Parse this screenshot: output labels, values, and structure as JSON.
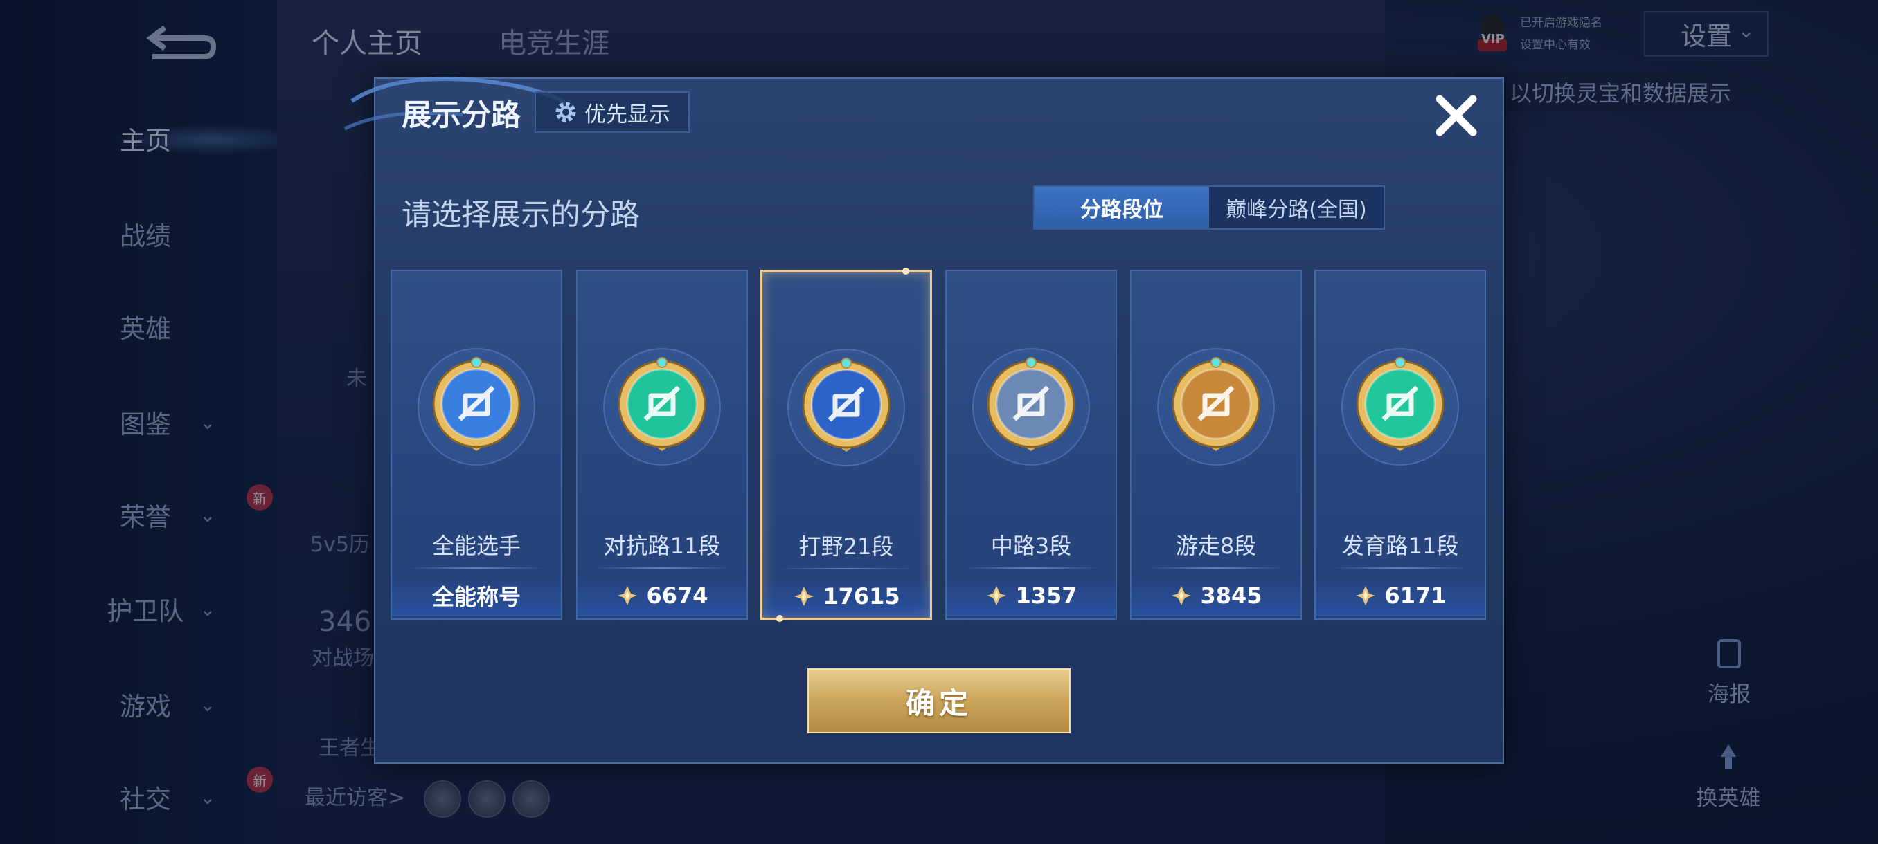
{
  "background": {
    "nav": [
      {
        "label": "主页",
        "chevron": false,
        "active": true,
        "badge": ""
      },
      {
        "label": "战绩",
        "chevron": false,
        "active": false,
        "badge": ""
      },
      {
        "label": "英雄",
        "chevron": false,
        "active": false,
        "badge": ""
      },
      {
        "label": "图鉴",
        "chevron": true,
        "active": false,
        "badge": ""
      },
      {
        "label": "荣誉",
        "chevron": true,
        "active": false,
        "badge": "新"
      },
      {
        "label": "护卫队",
        "chevron": true,
        "active": false,
        "badge": ""
      },
      {
        "label": "游戏",
        "chevron": true,
        "active": false,
        "badge": ""
      },
      {
        "label": "社交",
        "chevron": true,
        "active": false,
        "badge": "新"
      }
    ],
    "tabs": [
      "个人主页",
      "电竞生涯"
    ],
    "recent_visitors_label": "最近访客>",
    "partial_texts": [
      "5v5历",
      "346",
      "对战场",
      "王者生",
      "未"
    ],
    "vip_label": "VIP",
    "vip_line1": "已开启游戏隐名",
    "vip_line2": "设置中心有效",
    "settings_label": "设置",
    "hint_text": "以切换灵宝和数据展示",
    "right_widgets": [
      "海报",
      "换英雄"
    ]
  },
  "modal": {
    "title": "展示分路",
    "priority_button": "优先显示",
    "subtitle": "请选择展示的分路",
    "segments": [
      {
        "label": "分路段位",
        "active": true
      },
      {
        "label": "巅峰分路(全国)",
        "active": false
      }
    ],
    "cards": [
      {
        "lane": "全能选手",
        "score": "全能称号",
        "has_gem": false,
        "selected": false,
        "badge_color": "#3a7fe0",
        "badge_icon": "all-round-icon"
      },
      {
        "lane": "对抗路11段",
        "score": "6674",
        "has_gem": true,
        "selected": false,
        "badge_color": "#1fc49a",
        "badge_icon": "clash-lane-icon"
      },
      {
        "lane": "打野21段",
        "score": "17615",
        "has_gem": true,
        "selected": true,
        "badge_color": "#2e63c9",
        "badge_icon": "jungle-icon"
      },
      {
        "lane": "中路3段",
        "score": "1357",
        "has_gem": true,
        "selected": false,
        "badge_color": "#6c88b4",
        "badge_icon": "mid-lane-icon"
      },
      {
        "lane": "游走8段",
        "score": "3845",
        "has_gem": true,
        "selected": false,
        "badge_color": "#c88a3a",
        "badge_icon": "roam-icon"
      },
      {
        "lane": "发育路11段",
        "score": "6171",
        "has_gem": true,
        "selected": false,
        "badge_color": "#21c79b",
        "badge_icon": "farm-lane-icon"
      }
    ],
    "confirm_label": "确定"
  },
  "colors": {
    "accent_gold": "#f1cf93",
    "segment_active": "#3d73c4"
  }
}
